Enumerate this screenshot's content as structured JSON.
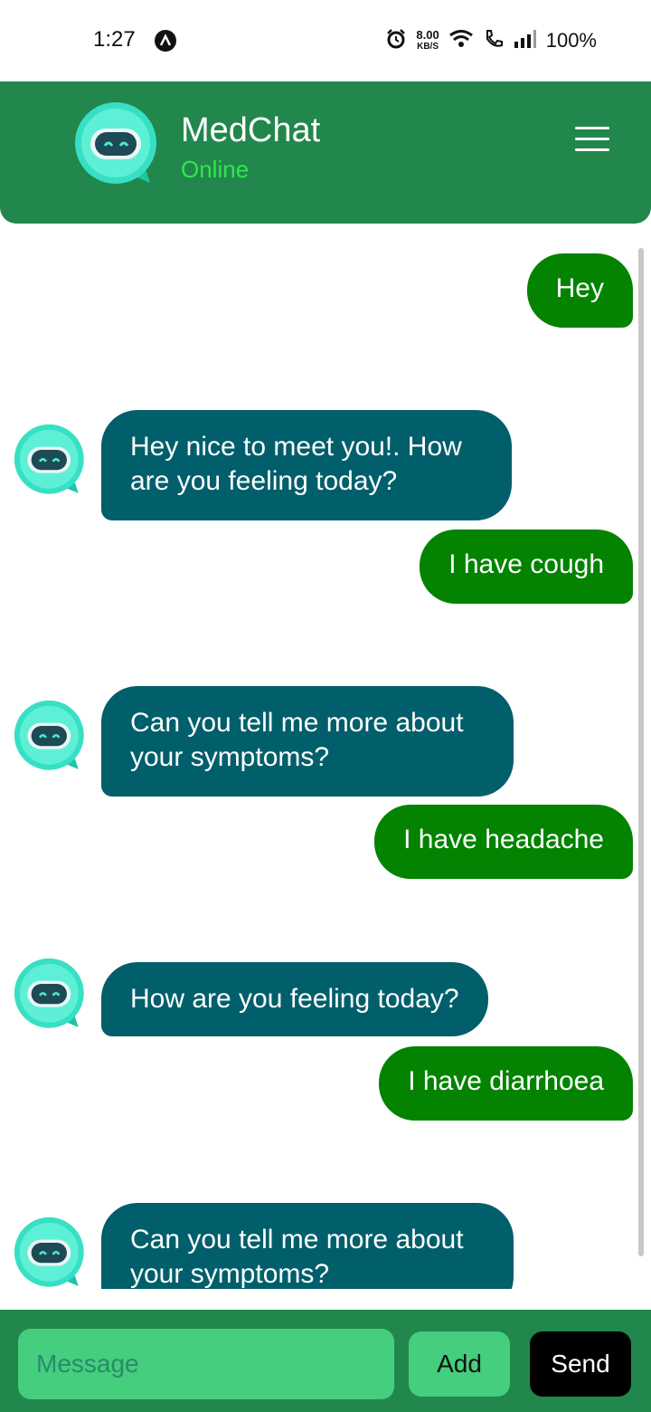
{
  "status_bar": {
    "time": "1:27",
    "speed_value": "8.00",
    "speed_unit": "KB/S",
    "battery": "100%"
  },
  "header": {
    "title": "MedChat",
    "status": "Online",
    "menu_icon": "hamburger-menu-icon"
  },
  "chat": {
    "messages": [
      {
        "sender": "user",
        "text": "Hey"
      },
      {
        "sender": "bot",
        "text": "Hey nice to meet you!. How are you feeling today?"
      },
      {
        "sender": "user",
        "text": "I have cough"
      },
      {
        "sender": "bot",
        "text": "Can you tell me more about your symptoms?"
      },
      {
        "sender": "user",
        "text": "I have headache"
      },
      {
        "sender": "bot",
        "text": "How are you feeling today?"
      },
      {
        "sender": "user",
        "text": "I have diarrhoea"
      },
      {
        "sender": "bot",
        "text": "Can you tell me more about your symptoms?"
      }
    ]
  },
  "input_bar": {
    "placeholder": "Message",
    "value": "",
    "add_label": "Add",
    "send_label": "Send"
  },
  "colors": {
    "header_bg": "#22874c",
    "online": "#2ee84c",
    "user_bubble": "#038300",
    "bot_bubble": "#015f6b",
    "input_bg": "#44ce7e",
    "send_bg": "#000000"
  }
}
